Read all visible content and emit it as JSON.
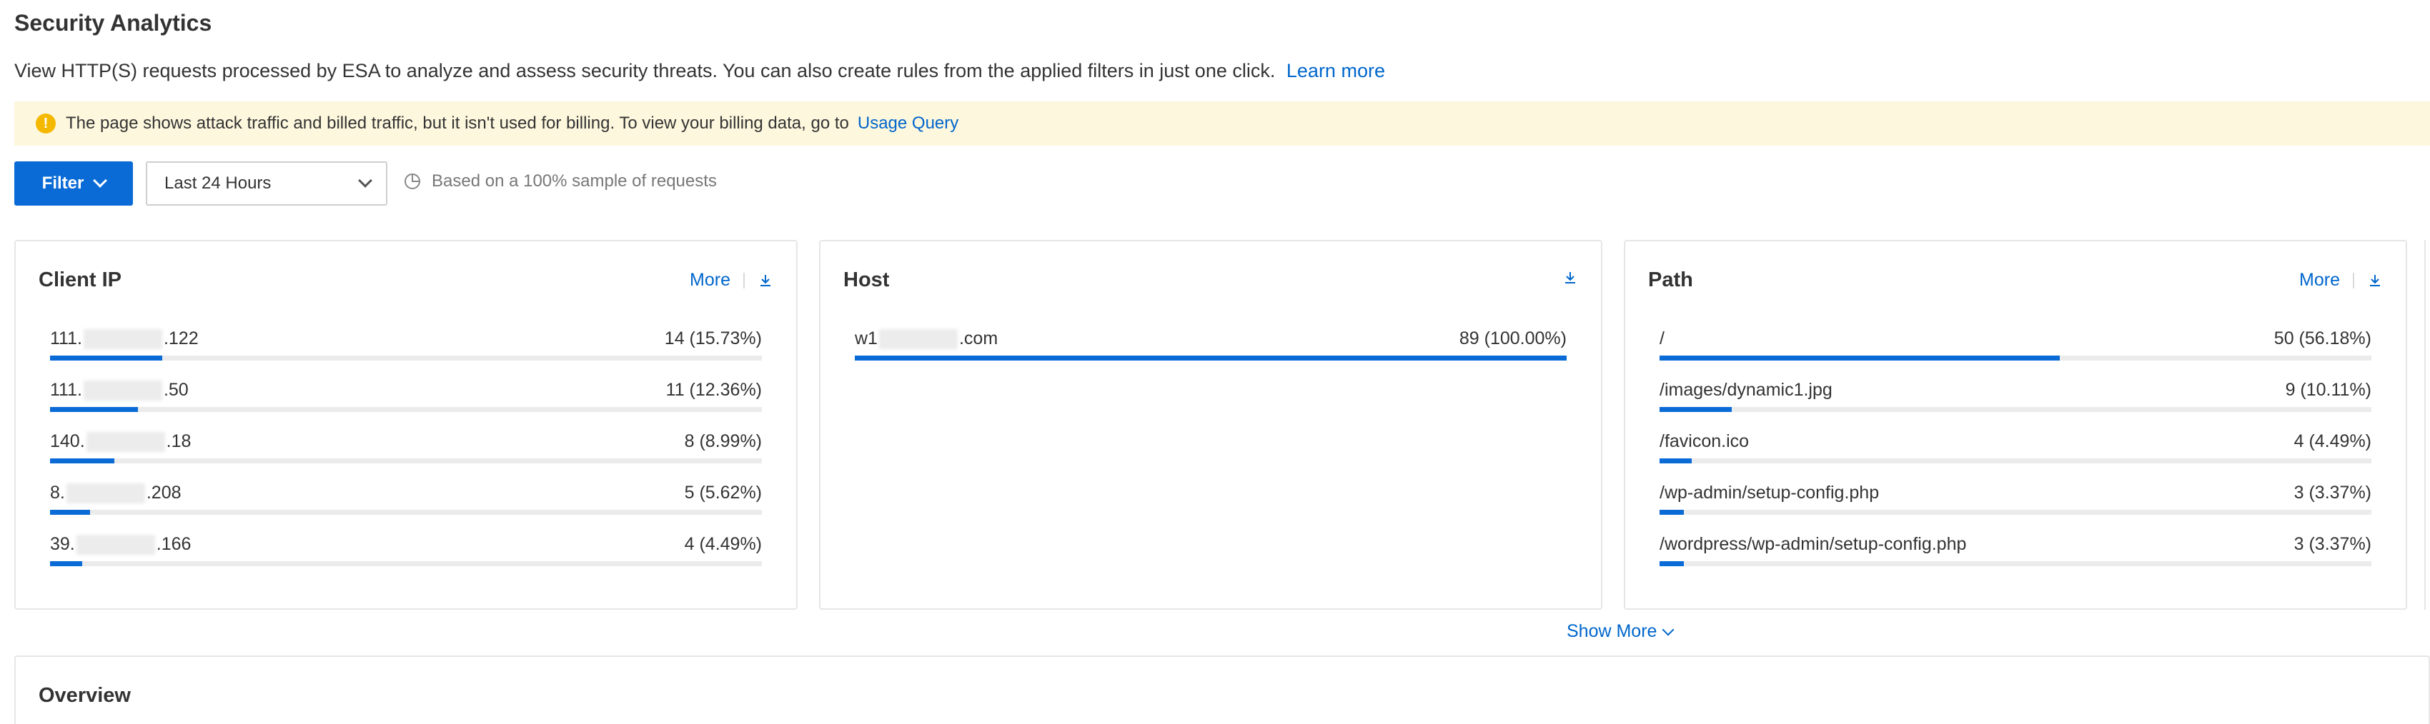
{
  "page": {
    "title": "Security Analytics",
    "intro": "View HTTP(S) requests processed by ESA to analyze and assess security threats. You can also create rules from the applied filters in just one click.",
    "learn_more": "Learn more"
  },
  "notice": {
    "text": "The page shows attack traffic and billed traffic, but it isn't used for billing. To view your billing data, go to",
    "link": "Usage Query",
    "icon": "warning-icon"
  },
  "toolbar": {
    "filter_label": "Filter",
    "time_range": "Last 24 Hours",
    "sample_note": "Based on a 100% sample of requests"
  },
  "cards": {
    "client_ip": {
      "title": "Client IP",
      "more": "More",
      "rows": [
        {
          "prefix": "111.",
          "suffix": ".122",
          "value": "14 (15.73%)",
          "pct": 15.73
        },
        {
          "prefix": "111.",
          "suffix": ".50",
          "value": "11 (12.36%)",
          "pct": 12.36
        },
        {
          "prefix": "140.",
          "suffix": ".18",
          "value": "8 (8.99%)",
          "pct": 8.99
        },
        {
          "prefix": "8.",
          "suffix": ".208",
          "value": "5 (5.62%)",
          "pct": 5.62
        },
        {
          "prefix": "39.",
          "suffix": ".166",
          "value": "4 (4.49%)",
          "pct": 4.49
        }
      ]
    },
    "host": {
      "title": "Host",
      "rows": [
        {
          "prefix": "w1",
          "suffix": ".com",
          "value": "89 (100.00%)",
          "pct": 100
        }
      ]
    },
    "path": {
      "title": "Path",
      "more": "More",
      "rows": [
        {
          "label": "/",
          "value": "50 (56.18%)",
          "pct": 56.18
        },
        {
          "label": "/images/dynamic1.jpg",
          "value": "9 (10.11%)",
          "pct": 10.11
        },
        {
          "label": "/favicon.ico",
          "value": "4 (4.49%)",
          "pct": 4.49
        },
        {
          "label": "/wp-admin/setup-config.php",
          "value": "3 (3.37%)",
          "pct": 3.37
        },
        {
          "label": "/wordpress/wp-admin/setup-config.php",
          "value": "3 (3.37%)",
          "pct": 3.37
        }
      ]
    }
  },
  "show_more": "Show More",
  "overview": {
    "title": "Overview"
  },
  "colors": {
    "accent": "#0a6bd6",
    "link": "#0066cc",
    "notice_bg": "#fdf7dd",
    "warning": "#f5b800"
  }
}
